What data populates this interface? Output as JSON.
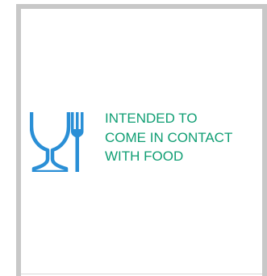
{
  "symbol": {
    "icon": "glass-fork-icon",
    "color": "#2a8fd6"
  },
  "text": {
    "color": "#0f9e73",
    "lines": [
      "INTENDED TO",
      "COME IN CONTACT",
      "WITH FOOD"
    ]
  }
}
